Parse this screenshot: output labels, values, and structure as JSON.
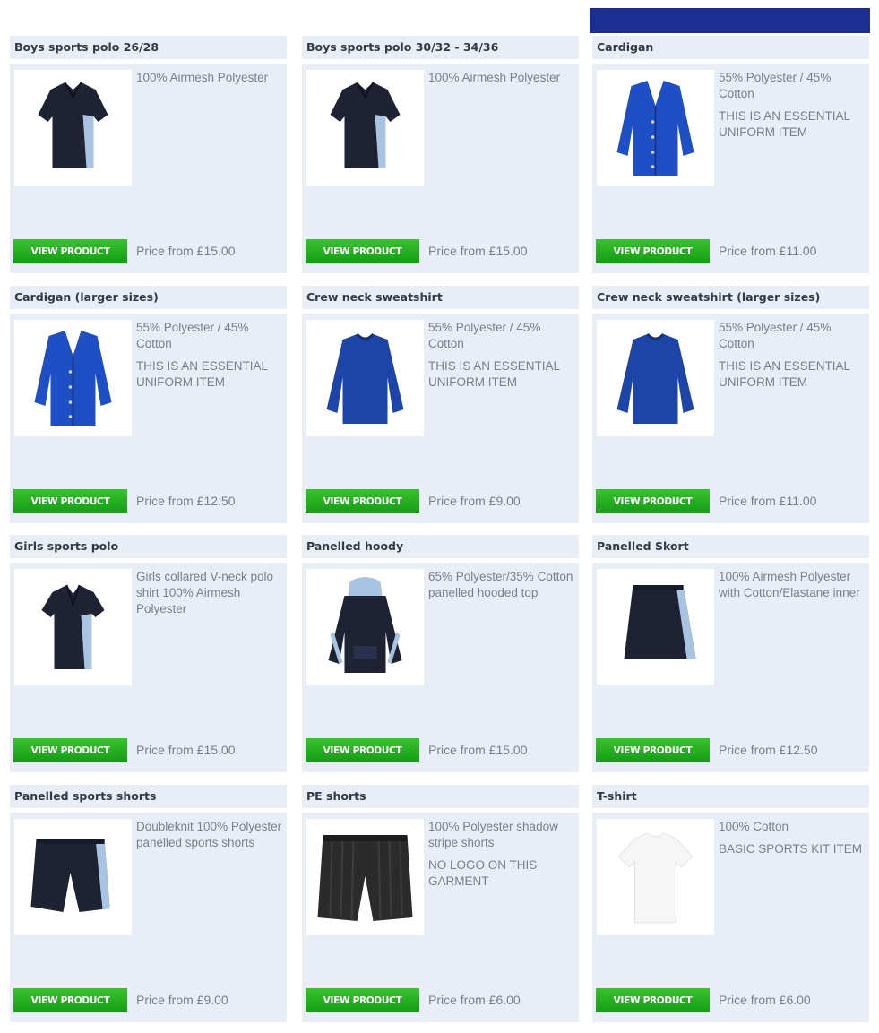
{
  "products": [
    {
      "title": "Boys sports polo 26/28",
      "desc": [
        "100% Airmesh Polyester"
      ],
      "button": "VIEW PRODUCT",
      "price": "Price from £15.00",
      "icon": "polo-shirt-icon"
    },
    {
      "title": "Boys sports polo 30/32 - 34/36",
      "desc": [
        "100% Airmesh Polyester"
      ],
      "button": "VIEW PRODUCT",
      "price": "Price from £15.00",
      "icon": "polo-shirt-icon"
    },
    {
      "title": "Cardigan",
      "desc": [
        "55% Polyester / 45% Cotton",
        "THIS IS AN ESSENTIAL UNIFORM ITEM"
      ],
      "button": "VIEW PRODUCT",
      "price": "Price from £11.00",
      "icon": "cardigan-icon"
    },
    {
      "title": "Cardigan (larger sizes)",
      "desc": [
        "55% Polyester / 45% Cotton",
        "THIS IS AN ESSENTIAL UNIFORM ITEM"
      ],
      "button": "VIEW PRODUCT",
      "price": "Price from £12.50",
      "icon": "cardigan-icon"
    },
    {
      "title": "Crew neck sweatshirt",
      "desc": [
        "55% Polyester / 45% Cotton",
        "THIS IS AN ESSENTIAL UNIFORM ITEM"
      ],
      "button": "VIEW PRODUCT",
      "price": "Price from £9.00",
      "icon": "sweatshirt-icon"
    },
    {
      "title": "Crew neck sweatshirt (larger sizes)",
      "desc": [
        "55% Polyester / 45% Cotton",
        "THIS IS AN ESSENTIAL UNIFORM ITEM"
      ],
      "button": "VIEW PRODUCT",
      "price": "Price from £11.00",
      "icon": "sweatshirt-icon"
    },
    {
      "title": "Girls sports polo",
      "desc": [
        "Girls collared V-neck polo shirt 100% Airmesh Polyester"
      ],
      "button": "VIEW PRODUCT",
      "price": "Price from £15.00",
      "icon": "girls-polo-icon"
    },
    {
      "title": "Panelled hoody",
      "desc": [
        "65% Polyester/35% Cotton panelled hooded top"
      ],
      "button": "VIEW PRODUCT",
      "price": "Price from £15.00",
      "icon": "hoody-icon"
    },
    {
      "title": "Panelled Skort",
      "desc": [
        "100% Airmesh Polyester with Cotton/Elastane inner"
      ],
      "button": "VIEW PRODUCT",
      "price": "Price from £12.50",
      "icon": "skort-icon"
    },
    {
      "title": "Panelled sports shorts",
      "desc": [
        "Doubleknit 100% Polyester panelled sports shorts"
      ],
      "button": "VIEW PRODUCT",
      "price": "Price from £9.00",
      "icon": "sports-shorts-icon"
    },
    {
      "title": "PE shorts",
      "desc": [
        "100% Polyester shadow stripe shorts",
        "NO LOGO ON THIS GARMENT"
      ],
      "button": "VIEW PRODUCT",
      "price": "Price from £6.00",
      "icon": "pe-shorts-icon"
    },
    {
      "title": "T-shirt",
      "desc": [
        "100% Cotton",
        "BASIC SPORTS KIT ITEM"
      ],
      "button": "VIEW PRODUCT",
      "price": "Price from £6.00",
      "icon": "tshirt-icon"
    }
  ],
  "colors": {
    "navy": "#1e2233",
    "royal": "#1f4fc4",
    "sweat": "#1d45a8",
    "sky": "#a9c3e3",
    "panel": "#e9eef6",
    "button": "#21ad1c",
    "banner": "#1c2e8f",
    "white_shirt": "#f6f6f6",
    "charcoal": "#2b2b2b"
  }
}
